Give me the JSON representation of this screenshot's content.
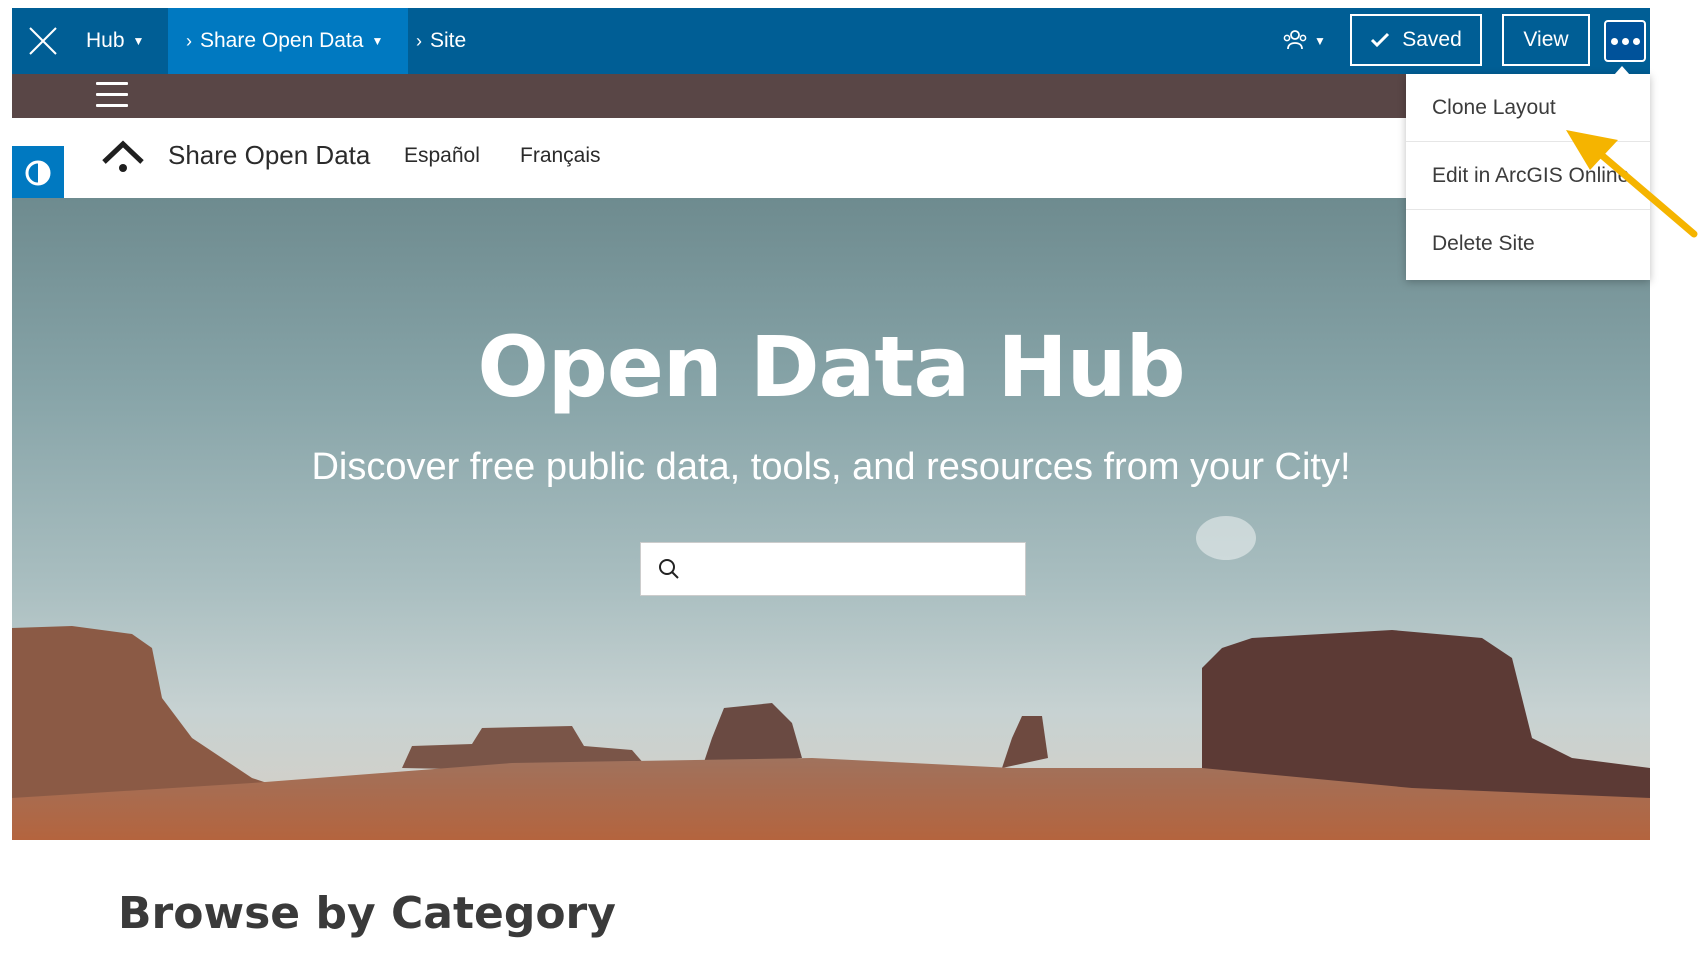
{
  "topbar": {
    "crumbs": {
      "hub": "Hub",
      "share": "Share Open Data",
      "site": "Site"
    },
    "saved_label": "Saved",
    "view_label": "View"
  },
  "menu": {
    "items": [
      "Clone Layout",
      "Edit in ArcGIS Online",
      "Delete Site"
    ]
  },
  "site": {
    "title": "Share Open Data",
    "nav": [
      "Español",
      "Français"
    ]
  },
  "hero": {
    "title": "Open Data Hub",
    "subtitle": "Discover free public data, tools, and resources from your City!",
    "search_value": ""
  },
  "browse": {
    "title": "Browse by Category"
  },
  "colors": {
    "topbar": "#005e95",
    "active_crumb": "#0079c1",
    "sitebar": "#594646",
    "annotation": "#f5b400"
  }
}
